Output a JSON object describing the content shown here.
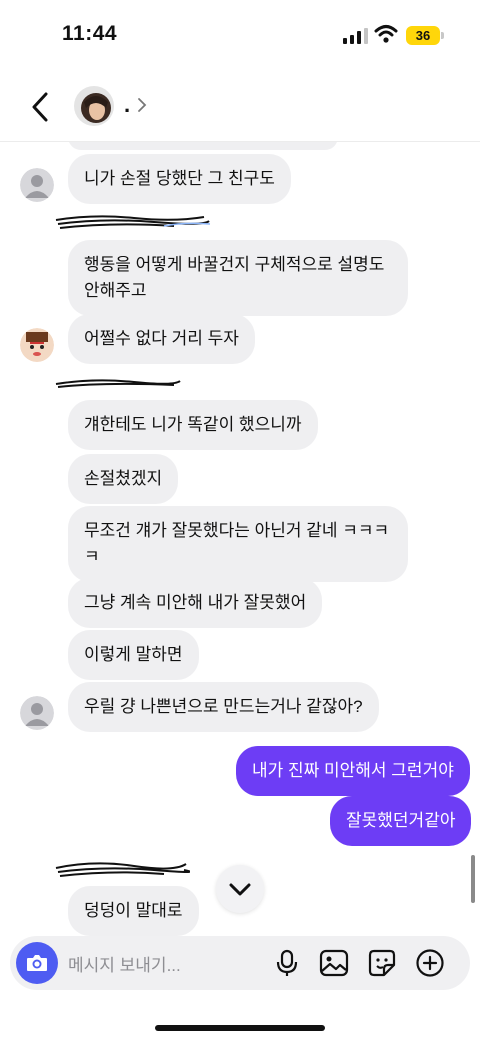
{
  "status_bar": {
    "time": "11:44",
    "battery": "36"
  },
  "header": {
    "contact_name": "."
  },
  "messages": [
    {
      "text": "니가 손절 당했단 그 친구도"
    },
    {
      "text": "행동을 어떻게 바꿀건지 구체적으로 설명도\n안해주고"
    },
    {
      "text": "어쩔수 없다 거리 두자"
    },
    {
      "text": "걔한테도 니가 똑같이 했으니까"
    },
    {
      "text": "손절쳤겠지"
    },
    {
      "text": "무조건 걔가 잘못했다는 아닌거 같네 ㅋㅋㅋ\nㅋ"
    },
    {
      "text": "그냥 계속 미안해 내가 잘못했어"
    },
    {
      "text": "이렇게 말하면"
    },
    {
      "text": "우릴 걍 나쁜년으로 만드는거나 같잖아?"
    },
    {
      "text": "내가 진짜 미안해서 그런거야"
    },
    {
      "text": "잘못했던거같아"
    },
    {
      "text": "덩덩이 말대로"
    }
  ],
  "composer": {
    "placeholder": "메시지 보내기..."
  },
  "icons": [
    "back-icon",
    "chevron-right-icon",
    "camera-icon",
    "microphone-icon",
    "gallery-icon",
    "sticker-icon",
    "plus-icon",
    "chevron-down-icon"
  ],
  "colors": {
    "outgoing_bubble": "#6d3df5",
    "incoming_bubble": "#efeff1",
    "camera_button": "#4e5cf2",
    "battery": "#ffd60a"
  }
}
